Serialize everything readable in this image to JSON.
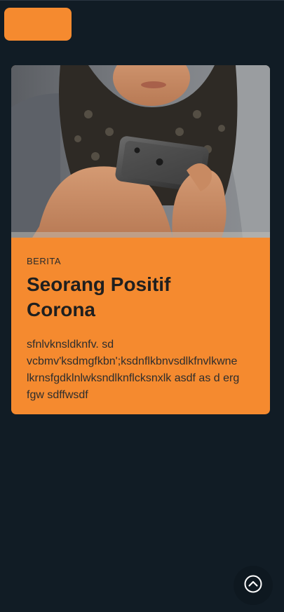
{
  "card": {
    "category": "BERITA",
    "title": "Seorang Positif Corona",
    "excerpt": "sfnlvknsldknfv. sd vcbmv'ksdmgfkbn';ksdnflkbnvsdlkfnvlkwne lkrnsfgdklnlwksndlknflcksnxlk asdf as d erg fgw sdffwsdf"
  },
  "icons": {
    "scroll_top": "chevron-up-circle-icon"
  },
  "colors": {
    "background": "#111c25",
    "accent": "#f58a2f"
  }
}
